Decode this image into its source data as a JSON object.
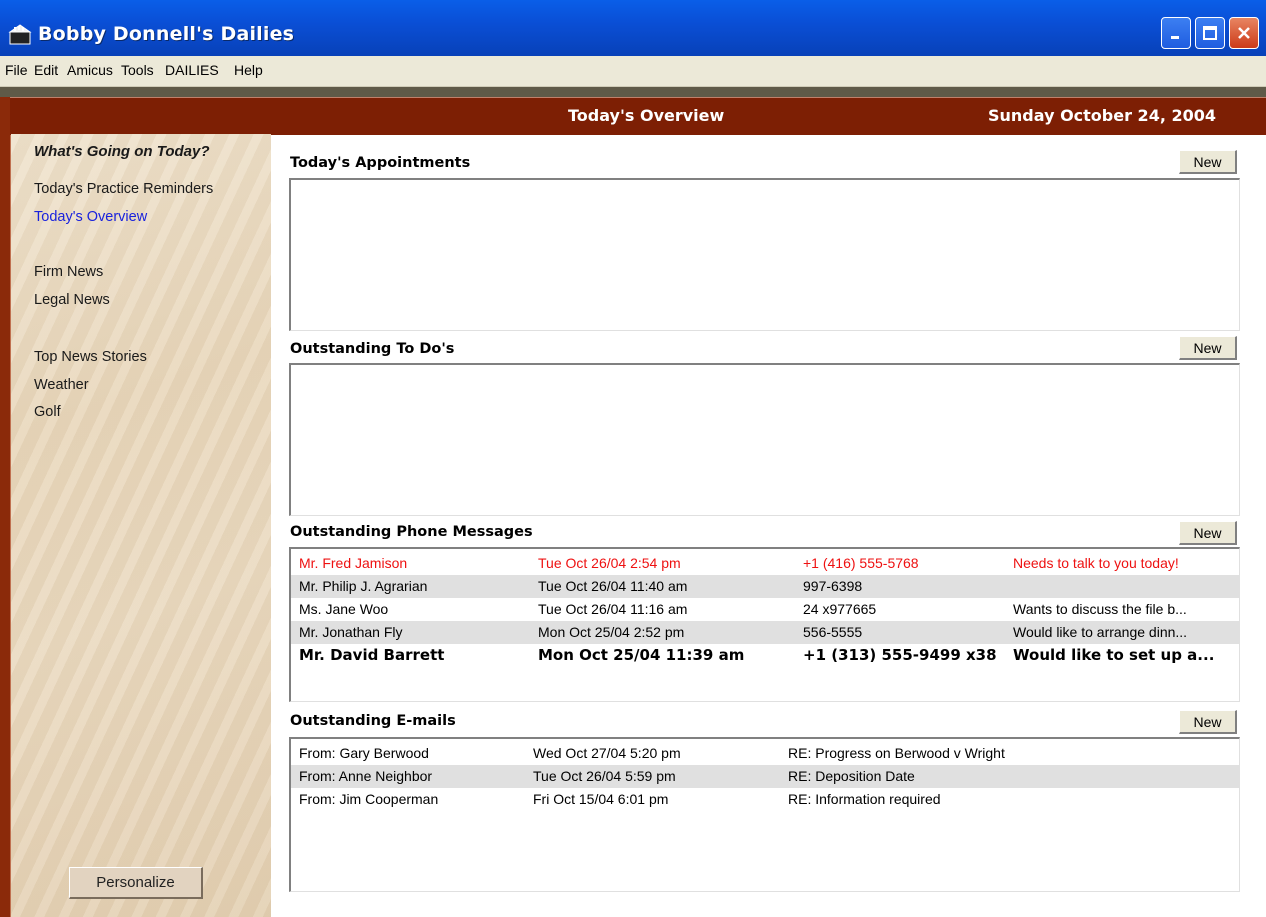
{
  "window": {
    "title": "Bobby Donnell's Dailies"
  },
  "menu": [
    "File",
    "Edit",
    "Amicus",
    "Tools",
    "DAILIES",
    "Help"
  ],
  "header": {
    "title": "Today's Overview",
    "date": "Sunday October 24, 2004"
  },
  "sidebar": {
    "heading": "What's Going on Today?",
    "items": [
      "Today's Practice Reminders",
      "Today's Overview",
      "Firm News",
      "Legal News",
      "Top News Stories",
      "Weather",
      "Golf"
    ],
    "active_item": "Today's Overview",
    "personalize_label": "Personalize"
  },
  "sections": {
    "appointments": {
      "title": "Today's Appointments",
      "new_label": "New"
    },
    "todos": {
      "title": "Outstanding To Do's",
      "new_label": "New"
    },
    "phone": {
      "title": "Outstanding Phone Messages",
      "new_label": "New",
      "rows": [
        {
          "name": "Mr. Fred Jamison",
          "time": "Tue Oct 26/04 2:54 pm",
          "phone": "+1 (416) 555-5768",
          "note": "Needs to talk to you today!",
          "style": "urgent"
        },
        {
          "name": "Mr. Philip J. Agrarian",
          "time": "Tue Oct 26/04 11:40 am",
          "phone": "997-6398",
          "note": "",
          "style": "normal"
        },
        {
          "name": "Ms. Jane Woo",
          "time": "Tue Oct 26/04 11:16 am",
          "phone": "24 x977665",
          "note": "Wants to discuss the file b...",
          "style": "normal"
        },
        {
          "name": "Mr. Jonathan Fly",
          "time": "Mon Oct 25/04 2:52 pm",
          "phone": "556-5555",
          "note": "Would like to arrange dinn...",
          "style": "normal"
        },
        {
          "name": "Mr. David Barrett",
          "time": "Mon Oct 25/04 11:39 am",
          "phone": "+1 (313) 555-9499 x38",
          "note": "Would like to set up a...",
          "style": "unread"
        }
      ]
    },
    "emails": {
      "title": "Outstanding E-mails",
      "new_label": "New",
      "rows": [
        {
          "from": "From: Gary Berwood",
          "time": "Wed Oct 27/04 5:20 pm",
          "subject": "RE: Progress on Berwood v Wright"
        },
        {
          "from": "From: Anne Neighbor",
          "time": "Tue Oct 26/04 5:59 pm",
          "subject": "RE: Deposition Date"
        },
        {
          "from": "From: Jim Cooperman",
          "time": "Fri Oct 15/04 6:01 pm",
          "subject": "RE: Information required"
        }
      ]
    }
  },
  "colors": {
    "header_bg": "#7d1f04",
    "urgent_text": "#ee1111",
    "active_link": "#1a22dd",
    "titlebar": "#0a4fd6"
  }
}
